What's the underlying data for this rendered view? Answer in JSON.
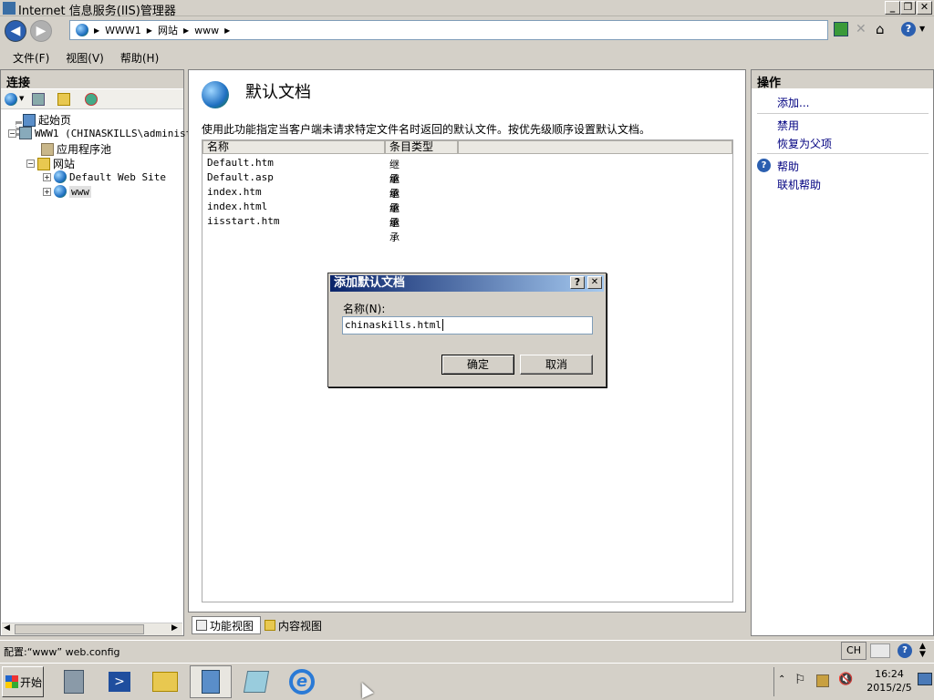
{
  "window": {
    "title": "Internet 信息服务(IIS)管理器"
  },
  "address": {
    "crumbs": [
      "WWW1",
      "网站",
      "www"
    ]
  },
  "menu": [
    "文件(F)",
    "视图(V)",
    "帮助(H)"
  ],
  "left": {
    "header": "连接",
    "tree": {
      "start": "起始页",
      "server": "WWW1 (CHINASKILLS\\administ",
      "apppools": "应用程序池",
      "sites": "网站",
      "site1": "Default Web Site",
      "site2": "www"
    }
  },
  "center": {
    "title": "默认文档",
    "description": "使用此功能指定当客户端未请求特定文件名时返回的默认文件。按优先级顺序设置默认文档。",
    "columns": [
      "名称",
      "条目类型"
    ],
    "rows": [
      [
        "Default.htm",
        "继承"
      ],
      [
        "Default.asp",
        "继承"
      ],
      [
        "index.htm",
        "继承"
      ],
      [
        "index.html",
        "继承"
      ],
      [
        "iisstart.htm",
        "继承"
      ]
    ],
    "tab_features": "功能视图",
    "tab_content": "内容视图"
  },
  "right": {
    "header": "操作",
    "add": "添加...",
    "disable": "禁用",
    "revert": "恢复为父项",
    "help": "帮助",
    "online_help": "联机帮助"
  },
  "dialog": {
    "title": "添加默认文档",
    "label": "名称(N):",
    "value": "chinaskills.html",
    "ok": "确定",
    "cancel": "取消",
    "help_btn": "?",
    "close_btn": "✕"
  },
  "status": {
    "text": "配置:“www” web.config",
    "lang": "CH"
  },
  "taskbar": {
    "start": "开始",
    "time": "16:24",
    "date": "2015/2/5"
  }
}
